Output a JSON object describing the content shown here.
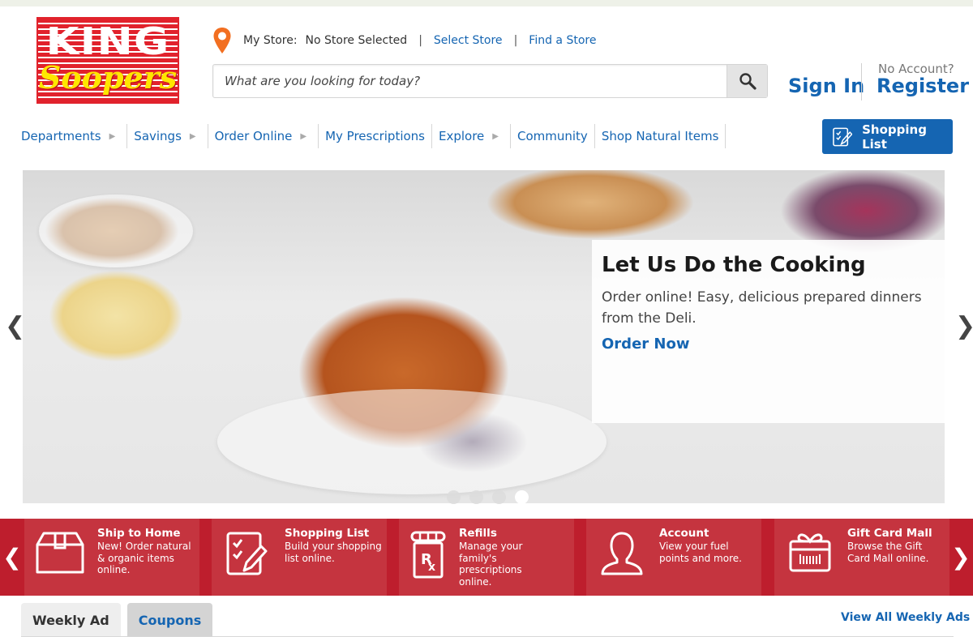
{
  "brand": {
    "logo_top": "KING",
    "logo_bottom": "Soopers",
    "colors": {
      "red": "#e1222c",
      "yellow": "#ffe600",
      "blue": "#1565b2",
      "quick_bar": "#be1e2d",
      "pin_orange": "#f26f21"
    }
  },
  "store": {
    "label": "My Store:",
    "value": "No Store Selected",
    "separator": "|",
    "select_link": "Select Store",
    "find_link": "Find a Store",
    "icon": "map-pin-icon"
  },
  "search": {
    "placeholder": "What are you looking for today?",
    "value": "",
    "button_icon": "search-icon"
  },
  "account": {
    "sign_in": "Sign In",
    "no_account": "No Account?",
    "register": "Register"
  },
  "nav": {
    "items": [
      {
        "label": "Departments",
        "has_arrow": true
      },
      {
        "label": "Savings",
        "has_arrow": true
      },
      {
        "label": "Order Online",
        "has_arrow": true
      },
      {
        "label": "My Prescriptions",
        "has_arrow": false
      },
      {
        "label": "Explore",
        "has_arrow": true
      },
      {
        "label": "Community",
        "has_arrow": false
      },
      {
        "label": "Shop Natural Items",
        "has_arrow": false
      }
    ],
    "arrow_glyph": "▶",
    "shopping_list": {
      "label": "Shopping List",
      "icon": "shopping-list-icon"
    }
  },
  "hero": {
    "title": "Let Us Do the Cooking",
    "description": "Order online! Easy, delicious prepared dinners from the Deli.",
    "cta": "Order Now",
    "prev": "❮",
    "next": "❯",
    "slide_count": 4,
    "active_slide": 4
  },
  "quick_links": {
    "prev": "❮",
    "next": "❯",
    "items": [
      {
        "title": "Ship to Home",
        "description": "New! Order natural & organic items online.",
        "icon": "box-icon"
      },
      {
        "title": "Shopping List",
        "description": "Build your shopping list online.",
        "icon": "checklist-pencil-icon"
      },
      {
        "title": "Refills",
        "description": "Manage your family's prescriptions online.",
        "icon": "rx-bottle-icon"
      },
      {
        "title": "Account",
        "description": "View your fuel points and more.",
        "icon": "user-icon"
      },
      {
        "title": "Gift Card Mall",
        "description": "Browse the Gift Card Mall online.",
        "icon": "gift-card-icon"
      }
    ]
  },
  "tabs": {
    "items": [
      {
        "label": "Weekly Ad",
        "active": true
      },
      {
        "label": "Coupons",
        "active": false
      }
    ],
    "view_all": "View All Weekly Ads"
  }
}
